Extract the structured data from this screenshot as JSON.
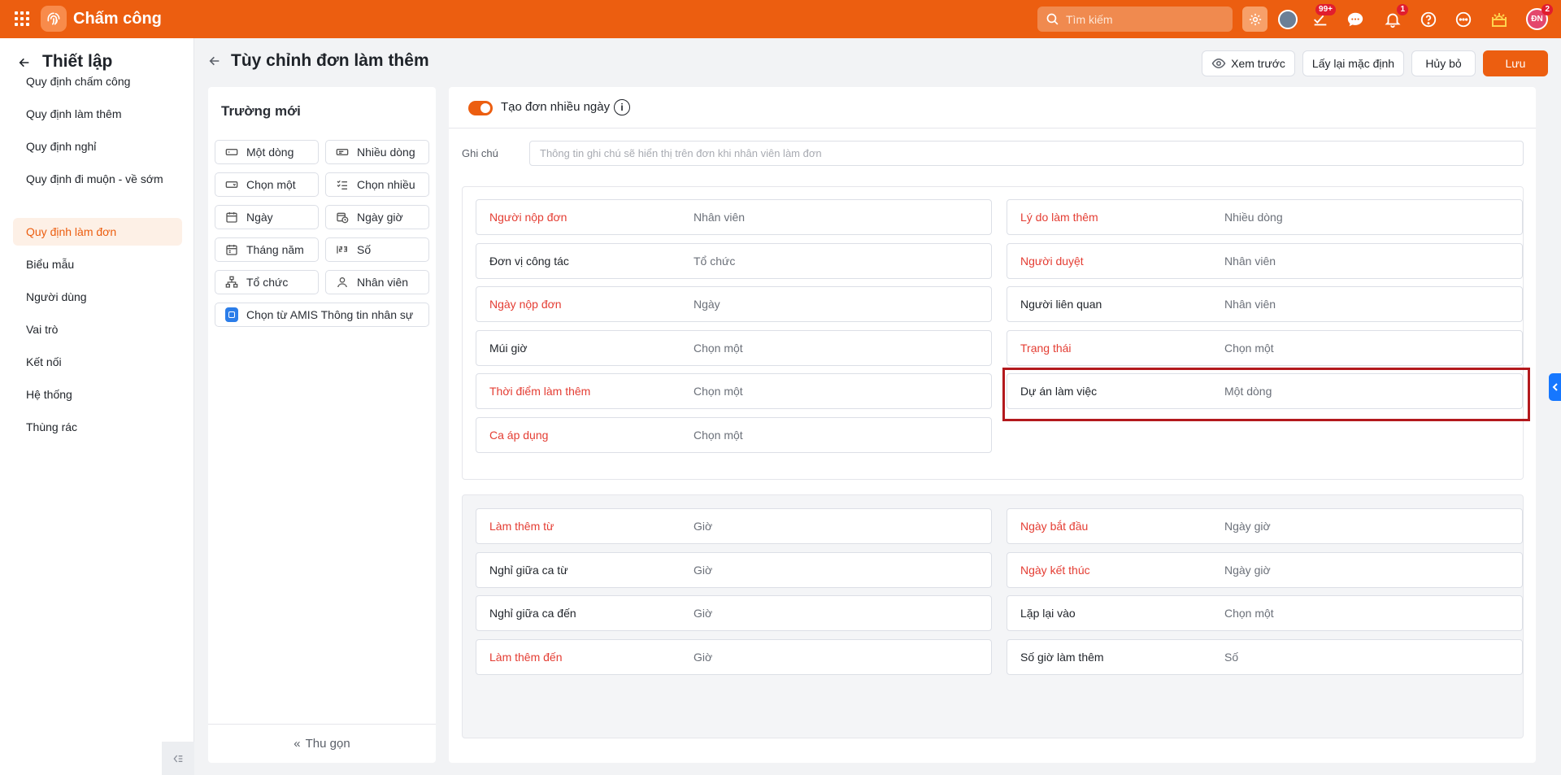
{
  "app": {
    "title": "Chấm công"
  },
  "topbar": {
    "search_placeholder": "Tìm kiếm",
    "badges": {
      "tasks": "99+",
      "notifications": "1",
      "avatar": "2"
    },
    "avatar_initials": "ĐN",
    "colors": {
      "brand": "#ec5e10"
    }
  },
  "sidebar": {
    "title": "Thiết lập",
    "items": [
      {
        "label": "Quy định chấm công",
        "active": false
      },
      {
        "label": "Quy định làm thêm",
        "active": false
      },
      {
        "label": "Quy định nghỉ",
        "active": false
      },
      {
        "label": "Quy định đi muộn - về sớm",
        "active": false
      },
      {
        "label": "Quy định làm đơn",
        "active": true
      },
      {
        "label": "Biểu mẫu",
        "active": false
      },
      {
        "label": "Người dùng",
        "active": false
      },
      {
        "label": "Vai trò",
        "active": false
      },
      {
        "label": "Kết nối",
        "active": false
      },
      {
        "label": "Hệ thống",
        "active": false
      },
      {
        "label": "Thùng rác",
        "active": false
      }
    ]
  },
  "header": {
    "title": "Tùy chỉnh đơn làm thêm",
    "preview_label": "Xem trước",
    "reset_label": "Lấy lại mặc định",
    "cancel_label": "Hủy bỏ",
    "save_label": "Lưu"
  },
  "new_fields": {
    "title": "Trường mới",
    "items": [
      {
        "label": "Một dòng",
        "icon": "single-line-icon"
      },
      {
        "label": "Nhiều dòng",
        "icon": "multi-line-icon"
      },
      {
        "label": "Chọn một",
        "icon": "dropdown-icon"
      },
      {
        "label": "Chọn nhiều",
        "icon": "checklist-icon"
      },
      {
        "label": "Ngày",
        "icon": "calendar-icon"
      },
      {
        "label": "Ngày giờ",
        "icon": "datetime-icon"
      },
      {
        "label": "Tháng năm",
        "icon": "month-year-icon"
      },
      {
        "label": "Số",
        "icon": "number-icon"
      },
      {
        "label": "Tổ chức",
        "icon": "organization-icon"
      },
      {
        "label": "Nhân viên",
        "icon": "person-icon"
      },
      {
        "label": "Chọn từ AMIS Thông tin nhân sự",
        "icon": "amis-icon"
      }
    ],
    "collapse_label": "Thu gọn"
  },
  "form": {
    "multi_day_toggle": {
      "label": "Tạo đơn nhiều ngày",
      "on": true
    },
    "note": {
      "label": "Ghi chú",
      "placeholder": "Thông tin ghi chú sẽ hiển thị trên đơn khi nhân viên làm đơn"
    },
    "group1": {
      "left": [
        {
          "label": "Người nộp đơn",
          "type": "Nhân viên",
          "required": true
        },
        {
          "label": "Đơn vị công tác",
          "type": "Tổ chức",
          "required": false
        },
        {
          "label": "Ngày nộp đơn",
          "type": "Ngày",
          "required": true
        },
        {
          "label": "Múi giờ",
          "type": "Chọn một",
          "required": false
        },
        {
          "label": "Thời điểm làm thêm",
          "type": "Chọn một",
          "required": true
        },
        {
          "label": "Ca áp dụng",
          "type": "Chọn một",
          "required": true
        }
      ],
      "right": [
        {
          "label": "Lý do làm thêm",
          "type": "Nhiều dòng",
          "required": true
        },
        {
          "label": "Người duyệt",
          "type": "Nhân viên",
          "required": true
        },
        {
          "label": "Người liên quan",
          "type": "Nhân viên",
          "required": false
        },
        {
          "label": "Trạng thái",
          "type": "Chọn một",
          "required": true
        },
        {
          "label": "Dự án làm việc",
          "type": "Một dòng",
          "required": false
        }
      ]
    },
    "group2": {
      "left": [
        {
          "label": "Làm thêm từ",
          "type": "Giờ",
          "required": true
        },
        {
          "label": "Nghỉ giữa ca từ",
          "type": "Giờ",
          "required": false
        },
        {
          "label": "Nghỉ giữa ca đến",
          "type": "Giờ",
          "required": false
        },
        {
          "label": "Làm thêm đến",
          "type": "Giờ",
          "required": true
        }
      ],
      "right": [
        {
          "label": "Ngày bắt đầu",
          "type": "Ngày giờ",
          "required": true
        },
        {
          "label": "Ngày kết thúc",
          "type": "Ngày giờ",
          "required": true
        },
        {
          "label": "Lặp lại vào",
          "type": "Chọn một",
          "required": false
        },
        {
          "label": "Số giờ làm thêm",
          "type": "Số",
          "required": false
        }
      ]
    }
  }
}
